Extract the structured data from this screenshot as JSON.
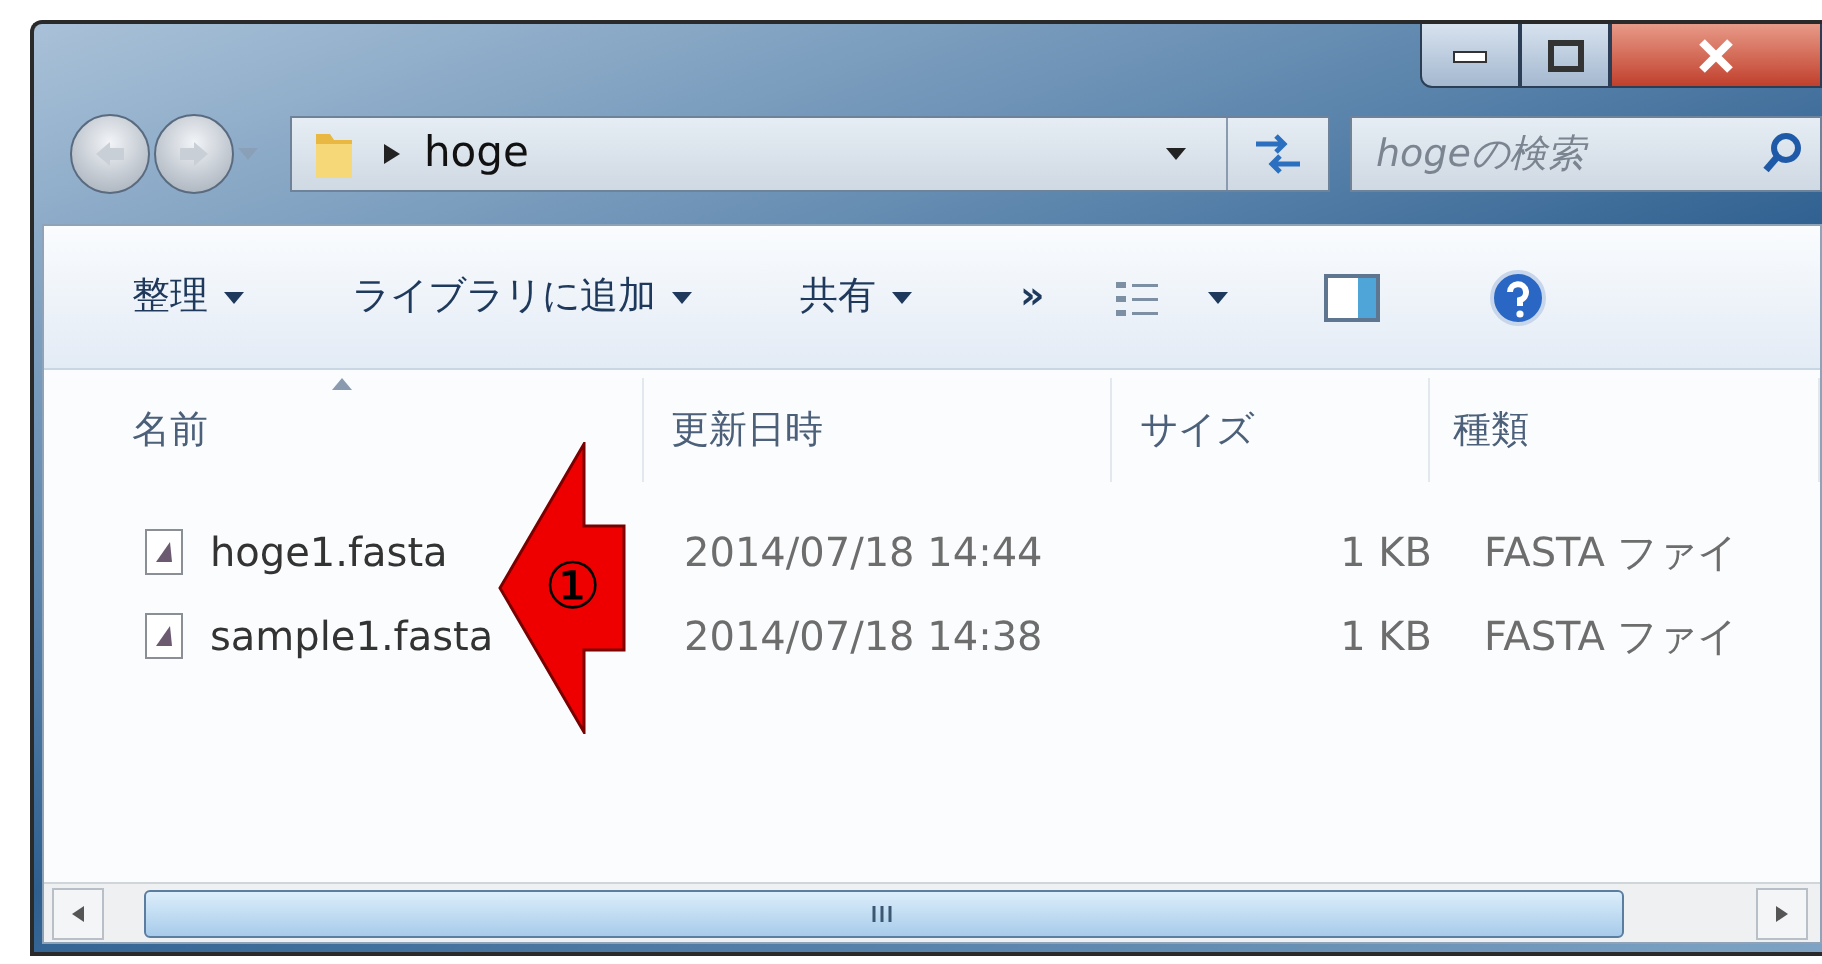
{
  "address_bar": {
    "path": [
      "hoge"
    ]
  },
  "search": {
    "placeholder": "hogeの検索"
  },
  "toolbar": {
    "items": [
      {
        "label": "整理",
        "kind": "menu"
      },
      {
        "label": "ライブラリに追加",
        "kind": "menu"
      },
      {
        "label": "共有",
        "kind": "menu"
      },
      {
        "label": "»",
        "kind": "overflow"
      }
    ]
  },
  "columns": [
    {
      "label": "名前",
      "sorted": true
    },
    {
      "label": "更新日時",
      "sorted": false
    },
    {
      "label": "サイズ",
      "sorted": false
    },
    {
      "label": "種類",
      "sorted": false
    }
  ],
  "files": [
    {
      "name": "hoge1.fasta",
      "modified": "2014/07/18 14:44",
      "size": "1 KB",
      "type": "FASTA ファイ"
    },
    {
      "name": "sample1.fasta",
      "modified": "2014/07/18 14:38",
      "size": "1 KB",
      "type": "FASTA ファイ"
    }
  ],
  "annotation": {
    "label": "①"
  }
}
